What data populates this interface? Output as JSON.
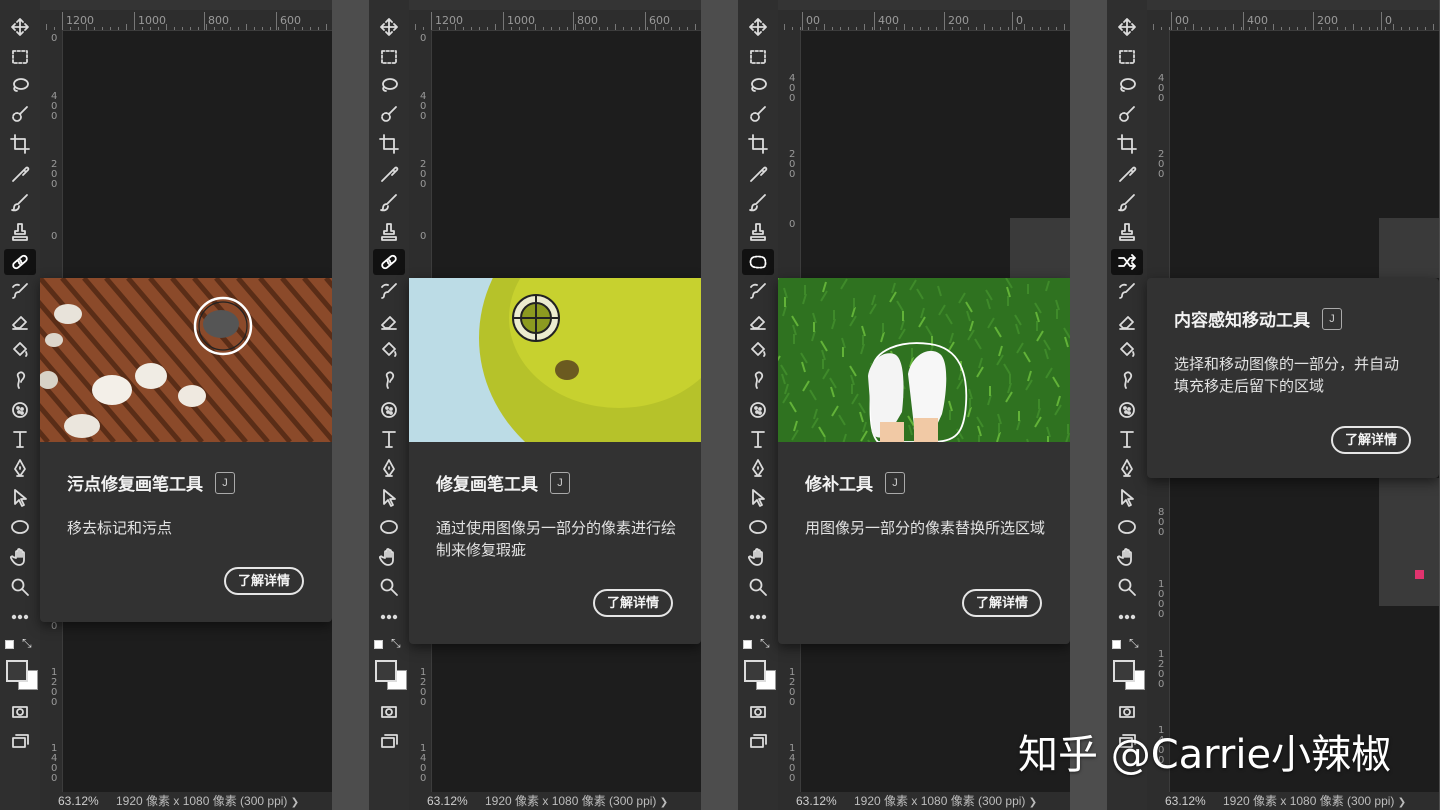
{
  "panels": [
    {
      "h_ruler": [
        "1200",
        "1000",
        "800",
        "600"
      ],
      "v_ruler": [
        "0",
        "400",
        "200",
        "0",
        "0",
        "1200",
        "1400"
      ],
      "tip_title": "污点修复画笔工具",
      "tip_key": "J",
      "tip_desc": "移去标记和污点",
      "tip_button": "了解详情",
      "zoom": "63.12%",
      "doc_info": "1920 像素 x 1080 像素 (300 ppi)",
      "doc_arrow": "❯"
    },
    {
      "h_ruler": [
        "1200",
        "1000",
        "800",
        "600"
      ],
      "v_ruler": [
        "0",
        "400",
        "200",
        "0",
        "1200",
        "1400"
      ],
      "tip_title": "修复画笔工具",
      "tip_key": "J",
      "tip_desc": "通过使用图像另一部分的像素进行绘制来修复瑕疵",
      "tip_button": "了解详情",
      "zoom": "63.12%",
      "doc_info": "1920 像素 x 1080 像素 (300 ppi)",
      "doc_arrow": "❯"
    },
    {
      "h_ruler": [
        "00",
        "400",
        "200",
        "0"
      ],
      "v_ruler": [
        "400",
        "200",
        "0",
        "1200",
        "1400"
      ],
      "tip_title": "修补工具",
      "tip_key": "J",
      "tip_desc": "用图像另一部分的像素替换所选区域",
      "tip_button": "了解详情",
      "zoom": "63.12%",
      "doc_info": "1920 像素 x 1080 像素 (300 ppi)",
      "doc_arrow": "❯"
    },
    {
      "h_ruler": [
        "00",
        "400",
        "200",
        "0"
      ],
      "v_ruler": [
        "400",
        "200",
        "800",
        "1000",
        "1200",
        "1400"
      ],
      "tip_title": "内容感知移动工具",
      "tip_key": "J",
      "tip_desc": "选择和移动图像的一部分，并自动填充移走后留下的区域",
      "tip_button": "了解详情",
      "zoom": "63.12%",
      "doc_info": "1920 像素 x 1080 像素 (300 ppi)",
      "doc_arrow": "❯"
    }
  ],
  "tools": [
    "move-icon",
    "marquee-icon",
    "lasso-icon",
    "quick-select-icon",
    "crop-icon",
    "eyedropper-icon",
    "brush-icon",
    "stamp-icon",
    "healing-icon",
    "history-brush-icon",
    "eraser-icon",
    "paint-bucket-icon",
    "smudge-icon",
    "sponge-icon",
    "type-icon",
    "pen-icon",
    "path-select-icon",
    "ellipse-icon",
    "hand-icon",
    "zoom-icon",
    "more-icon"
  ],
  "colors": {
    "foreground": "#3a3a3a",
    "background": "#ffffff",
    "accent_pink": "#e0336e"
  },
  "watermark": "知乎 @Carrie小辣椒"
}
